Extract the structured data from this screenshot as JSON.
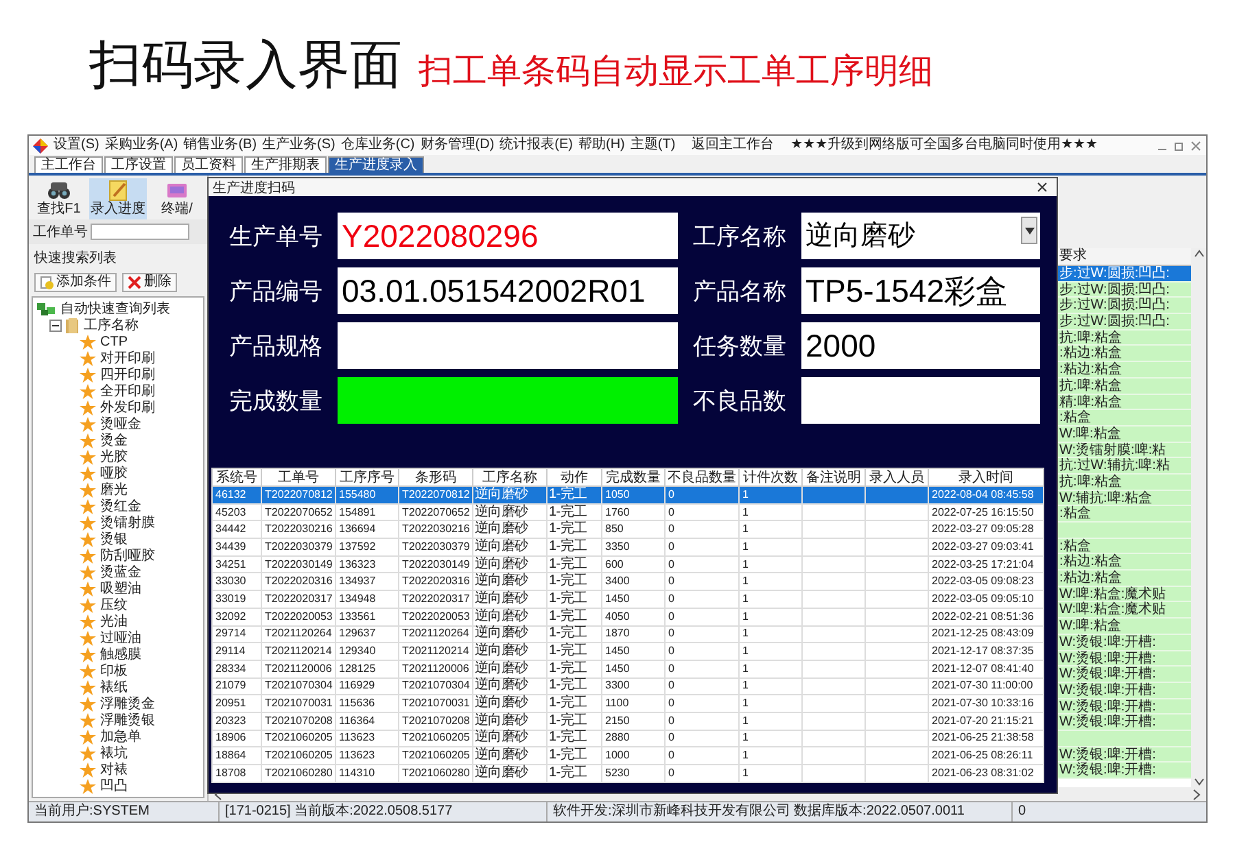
{
  "header": {
    "title": "扫码录入界面",
    "subtitle": "扫工单条码自动显示工单工序明细"
  },
  "menu": [
    "设置(S)",
    "采购业务(A)",
    "销售业务(B)",
    "生产业务(S)",
    "仓库业务(C)",
    "财务管理(D)",
    "统计报表(E)",
    "帮助(H)",
    "主题(T)"
  ],
  "menu_return": "返回主工作台",
  "menu_notice": "★★★升级到网络版可全国多台电脑同时使用★★★",
  "tabs": [
    {
      "label": "主工作台",
      "selected": false
    },
    {
      "label": "工序设置",
      "selected": false
    },
    {
      "label": "员工资料",
      "selected": false
    },
    {
      "label": "生产排期表",
      "selected": false
    },
    {
      "label": "生产进度录入",
      "selected": true
    }
  ],
  "toolbar": [
    {
      "label": "查找F1",
      "kind": "find",
      "selected": false
    },
    {
      "label": "录入进度",
      "kind": "entry",
      "selected": true
    },
    {
      "label": "终端/",
      "kind": "terminal",
      "selected": false
    }
  ],
  "left_panel": {
    "order_label": "工作单号",
    "quick_search": "快速搜索列表",
    "buttons": [
      {
        "label": "添加条件",
        "kind": "add"
      },
      {
        "label": "删除",
        "kind": "delete"
      }
    ],
    "tree": {
      "label": "自动快速查询列表",
      "children": [
        {
          "label": "工序名称",
          "expanded": true,
          "children": [
            "CTP",
            "对开印刷",
            "四开印刷",
            "全开印刷",
            "外发印刷",
            "烫哑金",
            "烫金",
            "光胶",
            "哑胶",
            "磨光",
            "烫红金",
            "烫镭射膜",
            "烫银",
            "防刮哑胶",
            "烫蓝金",
            "吸塑油",
            "压纹",
            "光油",
            "过哑油",
            "触感膜",
            "印板",
            "裱纸",
            "浮雕烫金",
            "浮雕烫银",
            "加急单",
            "裱坑",
            "对裱",
            "凹凸"
          ]
        }
      ]
    }
  },
  "background_table": {
    "column_header": "要求",
    "rows": [
      {
        "text": "步:过W:圆损:凹凸:",
        "selected": true
      },
      {
        "text": "步:过W:圆损:凹凸:",
        "selected": false
      },
      {
        "text": "步:过W:圆损:凹凸:",
        "selected": false
      },
      {
        "text": "步:过W:圆损:凹凸:",
        "selected": false
      },
      {
        "text": "抗:啤:粘盒",
        "selected": false
      },
      {
        "text": ":粘边:粘盒",
        "selected": false
      },
      {
        "text": ":粘边:粘盒",
        "selected": false
      },
      {
        "text": "抗:啤:粘盒",
        "selected": false
      },
      {
        "text": "精:啤:粘盒",
        "selected": false
      },
      {
        "text": ":粘盒",
        "selected": false
      },
      {
        "text": "W:啤:粘盒",
        "selected": false
      },
      {
        "text": "W:烫镭射膜:啤:粘",
        "selected": false
      },
      {
        "text": "抗:过W:辅抗:啤:粘",
        "selected": false
      },
      {
        "text": "抗:啤:粘盒",
        "selected": false
      },
      {
        "text": "W:辅抗:啤:粘盒",
        "selected": false
      },
      {
        "text": ":粘盒",
        "selected": false
      },
      {
        "selected": false
      },
      {
        "text": ":粘盒",
        "selected": false
      },
      {
        "text": ":粘边:粘盒",
        "selected": false
      },
      {
        "text": ":粘边:粘盒",
        "selected": false
      },
      {
        "text": "W:啤:粘盒:魔术贴",
        "selected": false
      },
      {
        "text": "W:啤:粘盒:魔术贴",
        "selected": false
      },
      {
        "text": "W:啤:粘盒",
        "selected": false
      },
      {
        "text": "W:烫银:啤:开槽:",
        "selected": false
      },
      {
        "text": "W:烫银:啤:开槽:",
        "selected": false
      },
      {
        "text": "W:烫银:啤:开槽:",
        "selected": false
      },
      {
        "text": "W:烫银:啤:开槽:",
        "selected": false
      },
      {
        "text": "W:烫银:啤:开槽:",
        "selected": false
      },
      {
        "text": "W:烫银:啤:开槽:",
        "selected": false
      },
      {
        "selected": false
      },
      {
        "text": "W:烫银:啤:开槽:",
        "selected": false
      },
      {
        "text": "W:烫银:啤:开槽:",
        "selected": false
      }
    ]
  },
  "dialog": {
    "title": "生产进度扫码",
    "fields": [
      {
        "label": "生产单号",
        "value": "Y2022080296",
        "kind": "order"
      },
      {
        "label": "工序名称",
        "value": "逆向磨砂",
        "kind": "select"
      },
      {
        "label": "产品编号",
        "value": "03.01.051542002R01",
        "kind": "text"
      },
      {
        "label": "产品名称",
        "value": "TP5-1542彩盒",
        "kind": "text"
      },
      {
        "label": "产品规格",
        "kind": "text"
      },
      {
        "label": "任务数量",
        "value": "2000",
        "kind": "text"
      },
      {
        "label": "完成数量",
        "kind": "done"
      },
      {
        "label": "不良品数",
        "kind": "text"
      }
    ],
    "table": {
      "columns": [
        "系统号",
        "工单号",
        "工序序号",
        "条形码",
        "工序名称",
        "动作",
        "完成数量",
        "不良品数量",
        "计件次数",
        "备注说明",
        "录入人员",
        "录入时间"
      ],
      "rows": [
        {
          "sys": "46132",
          "order": "T2022070812",
          "seq": "155480",
          "barcode": "T2022070812",
          "process": "逆向磨砂",
          "action": "1-完工",
          "done": "1050",
          "bad": "0",
          "count": "1",
          "time": "2022-08-04 08:45:58",
          "selected": true
        },
        {
          "sys": "45203",
          "order": "T2022070652",
          "seq": "154891",
          "barcode": "T2022070652",
          "process": "逆向磨砂",
          "action": "1-完工",
          "done": "1760",
          "bad": "0",
          "count": "1",
          "time": "2022-07-25 16:15:50",
          "selected": false
        },
        {
          "sys": "34442",
          "order": "T2022030216",
          "seq": "136694",
          "barcode": "T2022030216",
          "process": "逆向磨砂",
          "action": "1-完工",
          "done": "850",
          "bad": "0",
          "count": "1",
          "time": "2022-03-27 09:05:28",
          "selected": false
        },
        {
          "sys": "34439",
          "order": "T2022030379",
          "seq": "137592",
          "barcode": "T2022030379",
          "process": "逆向磨砂",
          "action": "1-完工",
          "done": "3350",
          "bad": "0",
          "count": "1",
          "time": "2022-03-27 09:03:41",
          "selected": false
        },
        {
          "sys": "34251",
          "order": "T2022030149",
          "seq": "136323",
          "barcode": "T2022030149",
          "process": "逆向磨砂",
          "action": "1-完工",
          "done": "600",
          "bad": "0",
          "count": "1",
          "time": "2022-03-25 17:21:04",
          "selected": false
        },
        {
          "sys": "33030",
          "order": "T2022020316",
          "seq": "134937",
          "barcode": "T2022020316",
          "process": "逆向磨砂",
          "action": "1-完工",
          "done": "3400",
          "bad": "0",
          "count": "1",
          "time": "2022-03-05 09:08:23",
          "selected": false
        },
        {
          "sys": "33019",
          "order": "T2022020317",
          "seq": "134948",
          "barcode": "T2022020317",
          "process": "逆向磨砂",
          "action": "1-完工",
          "done": "1450",
          "bad": "0",
          "count": "1",
          "time": "2022-03-05 09:05:10",
          "selected": false
        },
        {
          "sys": "32092",
          "order": "T2022020053",
          "seq": "133561",
          "barcode": "T2022020053",
          "process": "逆向磨砂",
          "action": "1-完工",
          "done": "4050",
          "bad": "0",
          "count": "1",
          "time": "2022-02-21 08:51:36",
          "selected": false
        },
        {
          "sys": "29714",
          "order": "T2021120264",
          "seq": "129637",
          "barcode": "T2021120264",
          "process": "逆向磨砂",
          "action": "1-完工",
          "done": "1870",
          "bad": "0",
          "count": "1",
          "time": "2021-12-25 08:43:09",
          "selected": false
        },
        {
          "sys": "29114",
          "order": "T2021120214",
          "seq": "129340",
          "barcode": "T2021120214",
          "process": "逆向磨砂",
          "action": "1-完工",
          "done": "1450",
          "bad": "0",
          "count": "1",
          "time": "2021-12-17 08:37:35",
          "selected": false
        },
        {
          "sys": "28334",
          "order": "T2021120006",
          "seq": "128125",
          "barcode": "T2021120006",
          "process": "逆向磨砂",
          "action": "1-完工",
          "done": "1450",
          "bad": "0",
          "count": "1",
          "time": "2021-12-07 08:41:40",
          "selected": false
        },
        {
          "sys": "21079",
          "order": "T2021070304",
          "seq": "116929",
          "barcode": "T2021070304",
          "process": "逆向磨砂",
          "action": "1-完工",
          "done": "3300",
          "bad": "0",
          "count": "1",
          "time": "2021-07-30 11:00:00",
          "selected": false
        },
        {
          "sys": "20951",
          "order": "T2021070031",
          "seq": "115636",
          "barcode": "T2021070031",
          "process": "逆向磨砂",
          "action": "1-完工",
          "done": "1100",
          "bad": "0",
          "count": "1",
          "time": "2021-07-30 10:33:16",
          "selected": false
        },
        {
          "sys": "20323",
          "order": "T2021070208",
          "seq": "116364",
          "barcode": "T2021070208",
          "process": "逆向磨砂",
          "action": "1-完工",
          "done": "2150",
          "bad": "0",
          "count": "1",
          "time": "2021-07-20 21:15:21",
          "selected": false
        },
        {
          "sys": "18906",
          "order": "T2021060205",
          "seq": "113623",
          "barcode": "T2021060205",
          "process": "逆向磨砂",
          "action": "1-完工",
          "done": "2880",
          "bad": "0",
          "count": "1",
          "time": "2021-06-25 21:38:58",
          "selected": false
        },
        {
          "sys": "18864",
          "order": "T2021060205",
          "seq": "113623",
          "barcode": "T2021060205",
          "process": "逆向磨砂",
          "action": "1-完工",
          "done": "1000",
          "bad": "0",
          "count": "1",
          "time": "2021-06-25 08:26:11",
          "selected": false
        },
        {
          "sys": "18708",
          "order": "T2021060280",
          "seq": "114310",
          "barcode": "T2021060280",
          "process": "逆向磨砂",
          "action": "1-完工",
          "done": "5230",
          "bad": "0",
          "count": "1",
          "time": "2021-06-23 08:31:02",
          "selected": false
        }
      ]
    }
  },
  "status_bar": [
    "当前用户:SYSTEM",
    "[171-0215] 当前版本:2022.0508.5177",
    "软件开发:深圳市新峰科技开发有限公司 数据库版本:2022.0507.0011",
    "0"
  ]
}
